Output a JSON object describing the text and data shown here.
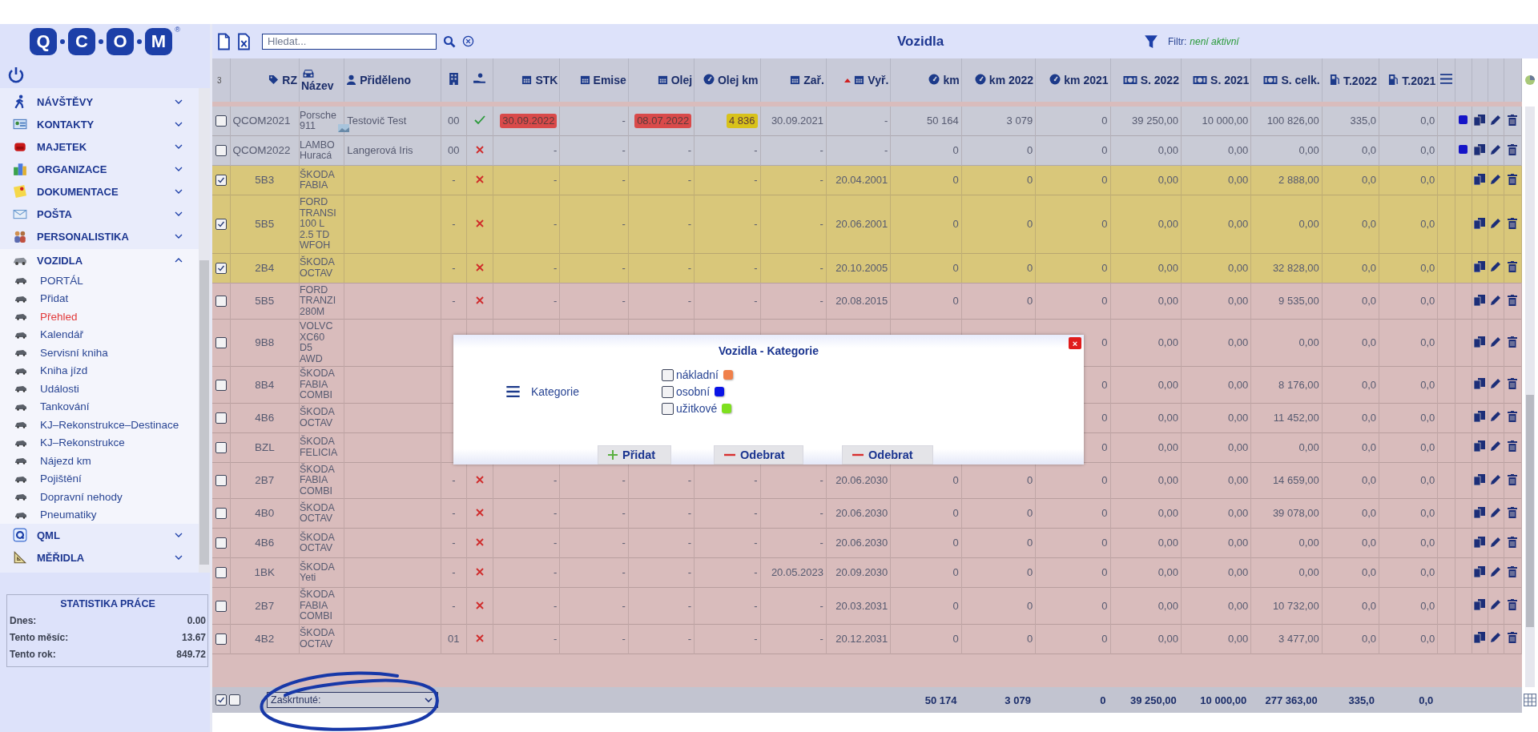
{
  "logo": {
    "letters": [
      "Q",
      "C",
      "O",
      "M"
    ],
    "mark": "®"
  },
  "nav": [
    {
      "label": "NÁVŠTĚVY",
      "expanded": false
    },
    {
      "label": "KONTAKTY",
      "expanded": false
    },
    {
      "label": "MAJETEK",
      "expanded": false
    },
    {
      "label": "ORGANIZACE",
      "expanded": false
    },
    {
      "label": "DOKUMENTACE",
      "expanded": false
    },
    {
      "label": "POŠTA",
      "expanded": false
    },
    {
      "label": "PERSONALISTIKA",
      "expanded": false
    },
    {
      "label": "VOZIDLA",
      "expanded": true,
      "children": [
        {
          "label": "PORTÁL",
          "selected": false
        },
        {
          "label": "Přidat",
          "selected": false
        },
        {
          "label": "Přehled",
          "selected": true
        },
        {
          "label": "Kalendář",
          "selected": false
        },
        {
          "label": "Servisní kniha",
          "selected": false
        },
        {
          "label": "Kniha jízd",
          "selected": false
        },
        {
          "label": "Události",
          "selected": false
        },
        {
          "label": "Tankování",
          "selected": false
        },
        {
          "label": "KJ–Rekonstrukce–Destinace",
          "selected": false
        },
        {
          "label": "KJ–Rekonstrukce",
          "selected": false
        },
        {
          "label": "Nájezd km",
          "selected": false
        },
        {
          "label": "Pojištění",
          "selected": false
        },
        {
          "label": "Dopravní nehody",
          "selected": false
        },
        {
          "label": "Pneumatiky",
          "selected": false
        }
      ]
    },
    {
      "label": "QML",
      "expanded": false
    },
    {
      "label": "MĚŘIDLA",
      "expanded": false
    }
  ],
  "stats": {
    "title": "STATISTIKA PRÁCE",
    "rows": [
      {
        "label": "Dnes:",
        "value": "0.00"
      },
      {
        "label": "Tento měsíc:",
        "value": "13.67"
      },
      {
        "label": "Tento rok:",
        "value": "849.72"
      }
    ]
  },
  "toolbar": {
    "search": {
      "placeholder": "Hledat..."
    },
    "title": "Vozidla",
    "filter": {
      "label": "Filtr:",
      "state": "není aktivní"
    }
  },
  "table": {
    "count": "3",
    "columns": [
      {
        "label": "RZ",
        "sorted": false
      },
      {
        "label": "Název",
        "sorted": false
      },
      {
        "label": "Přiděleno",
        "sorted": false
      },
      {
        "sorted": false
      },
      {
        "sorted": false
      },
      {
        "label": "STK",
        "sorted": false
      },
      {
        "label": "Emise",
        "sorted": false
      },
      {
        "label": "Olej",
        "sorted": false
      },
      {
        "label": "Olej km",
        "sorted": false
      },
      {
        "label": "Zař.",
        "sorted": false
      },
      {
        "label": "Vyř.",
        "sorted": true
      },
      {
        "label": "km",
        "sorted": false
      },
      {
        "label": "km 2022",
        "sorted": false
      },
      {
        "label": "km 2021",
        "sorted": false
      },
      {
        "label": "S. 2022",
        "sorted": false
      },
      {
        "label": "S. 2021",
        "sorted": false
      },
      {
        "label": "S. celk.",
        "sorted": false
      },
      {
        "label": "T.2022",
        "sorted": false
      },
      {
        "label": "T.2021",
        "sorted": false
      }
    ],
    "rows": [
      {
        "checked": false,
        "expired": false,
        "photo": true,
        "ok": true,
        "color": "#1414c8",
        "cells": [
          "QCOM2021",
          "Porsche\n911",
          "Testovič Test",
          "00",
          "",
          {
            "text": "30.09.2022",
            "color": "#d94a4a"
          },
          "-",
          {
            "text": "08.07.2022",
            "color": "#d94a4a"
          },
          {
            "text": "4 836",
            "color": "#d8c21a"
          },
          "30.09.2021",
          "-",
          "50 164",
          "3 079",
          "0",
          "39 250,00",
          "10 000,00",
          "100 826,00",
          "335,0",
          "0,0"
        ]
      },
      {
        "checked": false,
        "expired": false,
        "photo": false,
        "ok": false,
        "color": "#1414c8",
        "cells": [
          "QCOM2022",
          "LAMBO\nHuracá",
          "Langerová Iris",
          "00",
          "",
          "-",
          "-",
          "-",
          "-",
          "-",
          "-",
          "0",
          "0",
          "0",
          "0,00",
          "0,00",
          "0,00",
          "0,0",
          "0,0"
        ]
      },
      {
        "checked": true,
        "expired": true,
        "photo": false,
        "ok": false,
        "cells": [
          "5B3",
          "ŠKODA\nFABIA",
          "",
          "-",
          "",
          "-",
          "-",
          "-",
          "-",
          "-",
          "20.04.2001",
          "0",
          "0",
          "0",
          "0,00",
          "0,00",
          "2 888,00",
          "0,0",
          "0,0"
        ]
      },
      {
        "checked": true,
        "expired": true,
        "photo": false,
        "ok": false,
        "cells": [
          "5B5",
          "FORD\nTRANSI\n100 L\n2.5 TD\nWFOH",
          "",
          "-",
          "",
          "-",
          "-",
          "-",
          "-",
          "-",
          "20.06.2001",
          "0",
          "0",
          "0",
          "0,00",
          "0,00",
          "0,00",
          "0,0",
          "0,0"
        ]
      },
      {
        "checked": true,
        "expired": true,
        "photo": false,
        "ok": false,
        "cells": [
          "2B4",
          "ŠKODA\nOCTAV",
          "",
          "-",
          "",
          "-",
          "-",
          "-",
          "-",
          "-",
          "20.10.2005",
          "0",
          "0",
          "0",
          "0,00",
          "0,00",
          "32 828,00",
          "0,0",
          "0,0"
        ]
      },
      {
        "checked": false,
        "expired": true,
        "photo": false,
        "ok": false,
        "cells": [
          "5B5",
          "FORD\nTRANZI\n280M",
          "",
          "-",
          "",
          "-",
          "-",
          "-",
          "-",
          "-",
          "20.08.2015",
          "0",
          "0",
          "0",
          "0,00",
          "0,00",
          "9 535,00",
          "0,0",
          "0,0"
        ]
      },
      {
        "checked": false,
        "expired": true,
        "photo": false,
        "ok": null,
        "cells": [
          "9B8",
          "VOLVC\nXC60\nD5\nAWD",
          null,
          null,
          null,
          null,
          null,
          null,
          null,
          null,
          null,
          null,
          null,
          "0",
          "0,00",
          "0,00",
          "0,00",
          "0,0",
          "0,0"
        ]
      },
      {
        "checked": false,
        "expired": true,
        "photo": false,
        "ok": null,
        "cells": [
          "8B4",
          "ŠKODA\nFABIA\nCOMBI",
          null,
          null,
          null,
          null,
          null,
          null,
          null,
          null,
          null,
          null,
          null,
          "0",
          "0,00",
          "0,00",
          "8 176,00",
          "0,0",
          "0,0"
        ]
      },
      {
        "checked": false,
        "expired": true,
        "photo": false,
        "ok": null,
        "cells": [
          "4B6",
          "ŠKODA\nOCTAV",
          null,
          null,
          null,
          null,
          null,
          null,
          null,
          null,
          null,
          null,
          null,
          "0",
          "0,00",
          "0,00",
          "11 452,00",
          "0,0",
          "0,0"
        ]
      },
      {
        "checked": false,
        "expired": true,
        "photo": false,
        "ok": null,
        "cells": [
          "BZL",
          "ŠKODA\nFELICIA",
          null,
          null,
          null,
          null,
          null,
          null,
          null,
          null,
          null,
          null,
          null,
          "0",
          "0,00",
          "0,00",
          "0,00",
          "0,0",
          "0,0"
        ]
      },
      {
        "checked": false,
        "expired": true,
        "photo": false,
        "ok": false,
        "cells": [
          "2B7",
          "ŠKODA\nFABIA\nCOMBI",
          "",
          "-",
          "",
          "-",
          "-",
          "-",
          "-",
          "-",
          "20.06.2030",
          "0",
          "0",
          "0",
          "0,00",
          "0,00",
          "14 659,00",
          "0,0",
          "0,0"
        ]
      },
      {
        "checked": false,
        "expired": true,
        "photo": false,
        "ok": false,
        "cells": [
          "4B0",
          "ŠKODA\nOCTAV",
          "",
          "-",
          "",
          "-",
          "-",
          "-",
          "-",
          "-",
          "20.06.2030",
          "0",
          "0",
          "0",
          "0,00",
          "0,00",
          "39 078,00",
          "0,0",
          "0,0"
        ]
      },
      {
        "checked": false,
        "expired": true,
        "photo": false,
        "ok": false,
        "cells": [
          "4B6",
          "ŠKODA\nOCTAV",
          "",
          "-",
          "",
          "-",
          "-",
          "-",
          "-",
          "-",
          "20.06.2030",
          "0",
          "0",
          "0",
          "0,00",
          "0,00",
          "0,00",
          "0,0",
          "0,0"
        ]
      },
      {
        "checked": false,
        "expired": true,
        "photo": false,
        "ok": false,
        "cells": [
          "1BK",
          "ŠKODA\nYeti",
          "",
          "-",
          "",
          "-",
          "-",
          "-",
          "-",
          "20.05.2023",
          "20.09.2030",
          "0",
          "0",
          "0",
          "0,00",
          "0,00",
          "0,00",
          "0,0",
          "0,0"
        ]
      },
      {
        "checked": false,
        "expired": true,
        "photo": false,
        "ok": false,
        "cells": [
          "2B7",
          "ŠKODA\nFABIA\nCOMBI",
          "",
          "-",
          "",
          "-",
          "-",
          "-",
          "-",
          "-",
          "20.03.2031",
          "0",
          "0",
          "0",
          "0,00",
          "0,00",
          "10 732,00",
          "0,0",
          "0,0"
        ]
      },
      {
        "checked": false,
        "expired": true,
        "photo": false,
        "ok": false,
        "cells": [
          "4B2",
          "ŠKODA\nOCTAV",
          "",
          "01",
          "",
          "-",
          "-",
          "-",
          "-",
          "-",
          "20.12.2031",
          "0",
          "0",
          "0",
          "0,00",
          "0,00",
          "3 477,00",
          "0,0",
          "0,0"
        ]
      }
    ],
    "footer": {
      "select_all": true,
      "select_none": false,
      "action": "Zaškrtnuté:",
      "totals": [
        "50 174",
        "3 079",
        "0",
        "39 250,00",
        "10 000,00",
        "277 363,00",
        "335,0",
        "0,0"
      ]
    }
  },
  "dialog": {
    "title": "Vozidla - Kategorie",
    "close": "×",
    "field": "Kategorie",
    "options": [
      {
        "label": "nákladní",
        "checked": false,
        "color": "#f0804a"
      },
      {
        "label": "osobní",
        "checked": false,
        "color": "#0a14e6"
      },
      {
        "label": "užitkové",
        "checked": false,
        "color": "#7ee01e"
      }
    ],
    "buttons": [
      {
        "label": "Přidat",
        "kind": "add"
      },
      {
        "label": "Odebrat",
        "kind": "remove"
      },
      {
        "label": "Odebrat",
        "kind": "remove"
      }
    ]
  }
}
